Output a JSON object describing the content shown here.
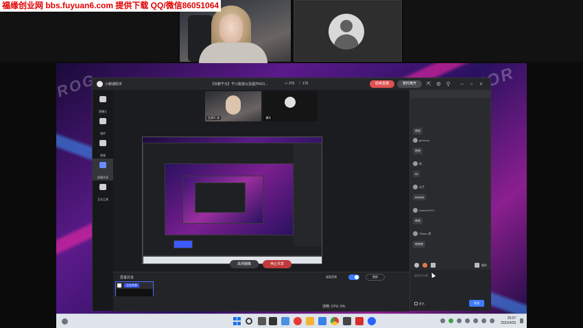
{
  "watermark": "福缘创业网 bbs.fuyuan6.com 提供下载 QQ/微信86051064",
  "app": {
    "name": "小鹅通助手",
    "room_title": "【日薪千元】千川投放以及提升ROI...",
    "viewers": "376",
    "likes": "170",
    "end_button": "结束直播",
    "pause_button": "暂时离开",
    "mini_tag_self": "主讲人 光",
    "mini_tag_other": "漫光"
  },
  "sidebar": {
    "items": [
      {
        "label": "直播大"
      },
      {
        "label": "课件"
      },
      {
        "label": "视频"
      },
      {
        "label": "屏幕共享"
      },
      {
        "label": "互动工具"
      }
    ]
  },
  "stage": {
    "close_share": "关闭摄像",
    "stop_share": "停止共享"
  },
  "bottom_panel": {
    "title": "屏幕共享",
    "thumb_label": "正在共享",
    "audio_label": "桌面音频",
    "more_button": "更换",
    "status": "流畅:     CPU:  6%"
  },
  "chat": {
    "messages": [
      {
        "user": "",
        "text": "哈哈"
      },
      {
        "user": "gbvsvua",
        "text": "哈哈"
      },
      {
        "user": "新",
        "text": "66"
      },
      {
        "user": "水手",
        "text": "666666"
      },
      {
        "user": "AutumnXXX...",
        "text": "哈哈"
      },
      {
        "user": "Tillians 果",
        "text": "哈哈哈"
      }
    ],
    "settings": "操作",
    "placeholder": "说点什么吧",
    "anonymous": "匿名",
    "send": "发送"
  },
  "taskbar": {
    "time": "20:07",
    "date": "2022/4/26"
  }
}
